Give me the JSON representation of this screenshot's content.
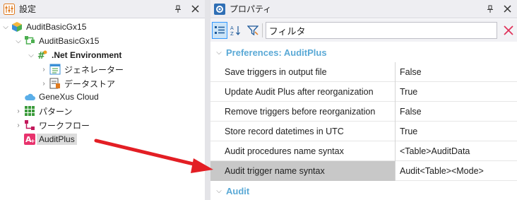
{
  "left_panel": {
    "title": "設定",
    "tree": [
      {
        "label": "AuditBasicGx15",
        "icon": "kb-cube-icon",
        "expanded": true
      },
      {
        "label": "AuditBasicGx15",
        "icon": "version-tree-icon",
        "expanded": true
      },
      {
        "label": ".Net Environment",
        "icon": "dotnet-environment-icon",
        "expanded": true
      },
      {
        "label": "ジェネレーター",
        "icon": "generator-icon",
        "expanded": false
      },
      {
        "label": "データストア",
        "icon": "datastore-icon",
        "expanded": false
      },
      {
        "label": "GeneXus Cloud",
        "icon": "cloud-icon"
      },
      {
        "label": "パターン",
        "icon": "patterns-grid-icon",
        "expanded": false
      },
      {
        "label": "ワークフロー",
        "icon": "workflow-icon",
        "expanded": false
      },
      {
        "label": "AuditPlus",
        "icon": "auditplus-icon"
      }
    ]
  },
  "right_panel": {
    "title": "プロパティ",
    "filter_label": "フィルタ",
    "filter_value": "",
    "category": "Preferences: AuditPlus",
    "properties": [
      {
        "name": "Save triggers in output file",
        "value": "False"
      },
      {
        "name": "Update Audit Plus after reorganization",
        "value": "True"
      },
      {
        "name": "Remove triggers before reorganization",
        "value": "False"
      },
      {
        "name": "Store record datetimes in UTC",
        "value": "True"
      },
      {
        "name": "Audit procedures name syntax",
        "value": "<Table>AuditData"
      },
      {
        "name": "Audit trigger name syntax",
        "value": "Audit<Table><Mode>"
      }
    ],
    "subcategory": "Audit"
  },
  "colors": {
    "accent": "#3399ff",
    "category_text": "#5aa9d6",
    "arrow": "#e31e24",
    "clear_x": "#e0325a"
  }
}
